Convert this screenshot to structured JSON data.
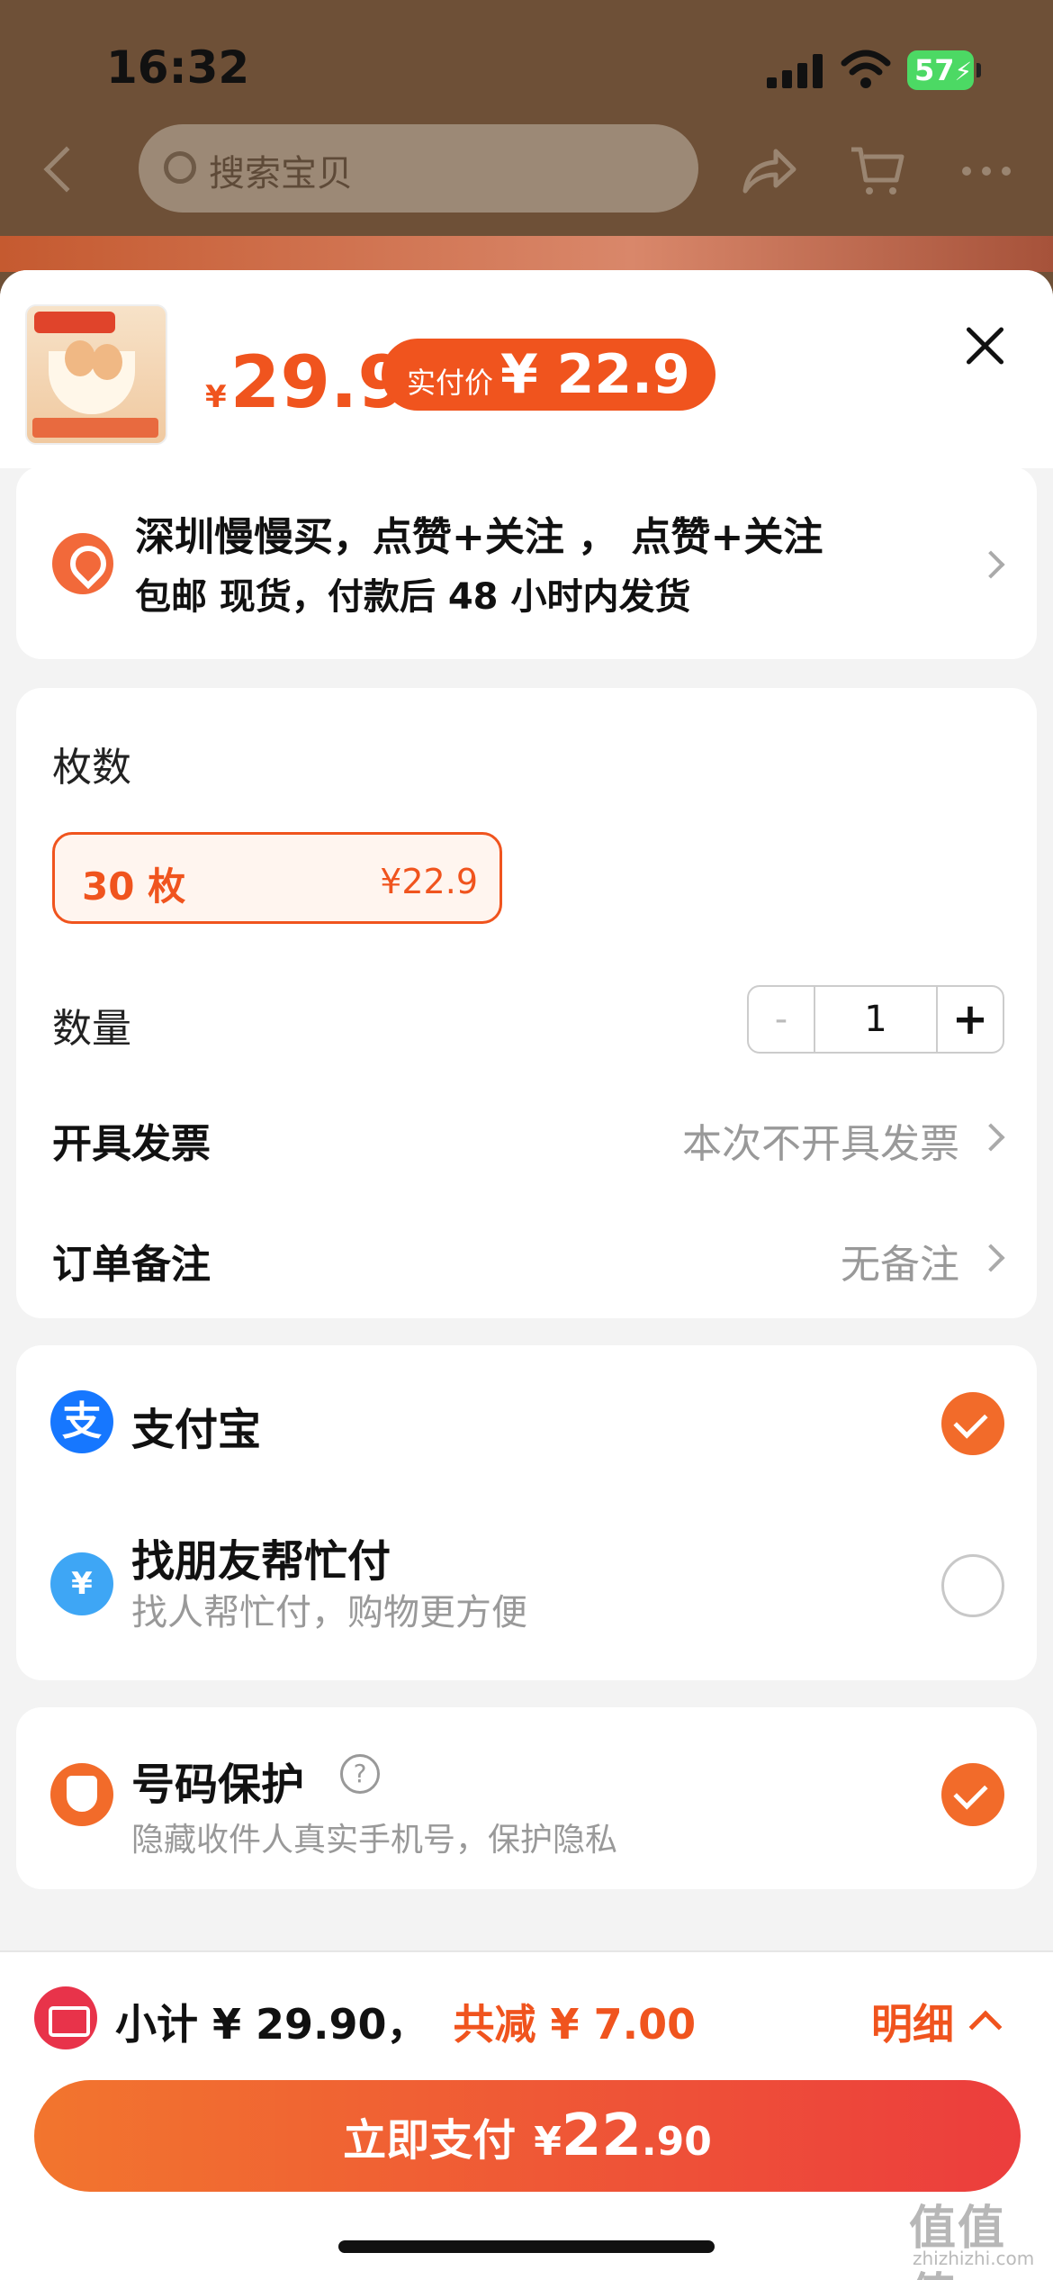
{
  "status_bar": {
    "time": "16:32",
    "battery": "57"
  },
  "nav": {
    "search_placeholder": "搜索宝贝"
  },
  "product": {
    "currency": "¥",
    "price": "29.9",
    "pay_price_label": "实付价",
    "pay_price": "¥ 22.9"
  },
  "address": {
    "line1": "深圳慢慢买，点赞+关注 ， 点赞+关注",
    "line2": "包邮  现货，付款后 48 小时内发货"
  },
  "spec": {
    "section_label": "枚数",
    "selected_option": {
      "name": "30 枚",
      "price": "¥22.9"
    },
    "quantity_label": "数量",
    "quantity_minus": "-",
    "quantity": "1",
    "quantity_plus": "+",
    "invoice_label": "开具发票",
    "invoice_value": "本次不开具发票",
    "note_label": "订单备注",
    "note_value": "无备注"
  },
  "payment": {
    "alipay": {
      "label": "支付宝",
      "checked": true
    },
    "friend_pay": {
      "label": "找朋友帮忙付",
      "sub": "找人帮忙付，购物更方便",
      "checked": false
    }
  },
  "protection": {
    "label": "号码保护",
    "sub": "隐藏收件人真实手机号，保护隐私",
    "checked": true
  },
  "footer": {
    "subtotal": "小计 ¥ 29.90，",
    "reduction": "共减 ¥ 7.00",
    "detail": "明细",
    "pay_button_label": "立即支付",
    "pay_button_currency": "¥",
    "pay_button_int": "22",
    "pay_button_dec": ".90"
  },
  "watermark": {
    "main": "值值值",
    "sub": "zhizhizhi.com"
  },
  "colors": {
    "accent": "#f0541e",
    "alipay": "#1677ff",
    "overlay": "#6e5037"
  }
}
